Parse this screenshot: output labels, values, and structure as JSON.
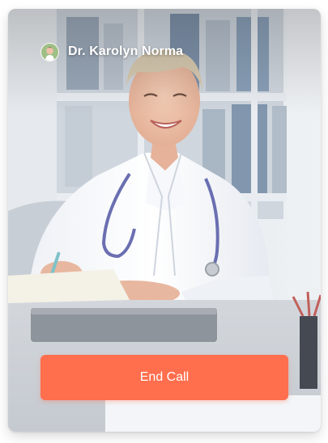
{
  "call": {
    "caller_name": "Dr. Karolyn Norma",
    "avatar_icon": "doctor-avatar",
    "end_call_label": "End Call"
  },
  "colors": {
    "end_call_bg": "#ff6e4d",
    "name_text": "#ffffff"
  }
}
